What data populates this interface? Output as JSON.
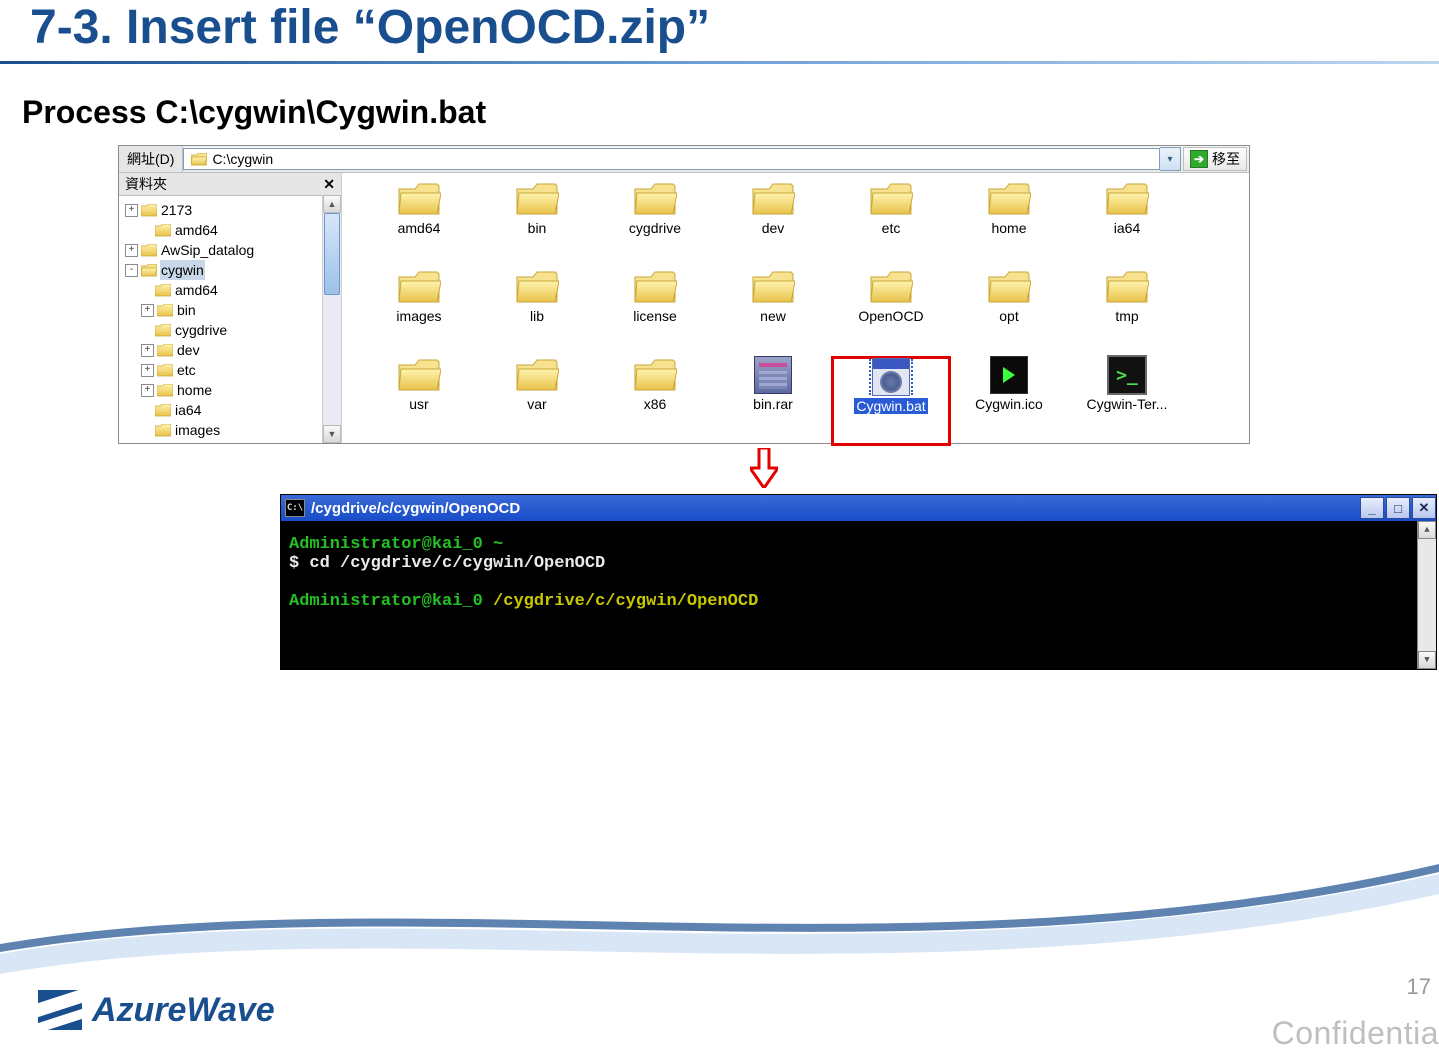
{
  "slide": {
    "title": "7-3. Insert file “OpenOCD.zip”",
    "subheading": "Process C:\\cygwin\\Cygwin.bat"
  },
  "explorer": {
    "address_label": "網址(D)",
    "address_value": "C:\\cygwin",
    "go_label": "移至",
    "tree_header": "資料夾",
    "tree": [
      {
        "indent": 0,
        "toggle": "+",
        "label": "2173"
      },
      {
        "indent": 1,
        "toggle": "",
        "label": "amd64"
      },
      {
        "indent": 0,
        "toggle": "+",
        "label": "AwSip_datalog"
      },
      {
        "indent": 0,
        "toggle": "-",
        "label": "cygwin",
        "selected": true,
        "open": true
      },
      {
        "indent": 1,
        "toggle": "",
        "label": "amd64"
      },
      {
        "indent": 1,
        "toggle": "+",
        "label": "bin"
      },
      {
        "indent": 1,
        "toggle": "",
        "label": "cygdrive"
      },
      {
        "indent": 1,
        "toggle": "+",
        "label": "dev"
      },
      {
        "indent": 1,
        "toggle": "+",
        "label": "etc"
      },
      {
        "indent": 1,
        "toggle": "+",
        "label": "home"
      },
      {
        "indent": 1,
        "toggle": "",
        "label": "ia64"
      },
      {
        "indent": 1,
        "toggle": "",
        "label": "images"
      }
    ],
    "items": [
      {
        "type": "folder",
        "label": "amd64"
      },
      {
        "type": "folder",
        "label": "bin"
      },
      {
        "type": "folder",
        "label": "cygdrive"
      },
      {
        "type": "folder",
        "label": "dev"
      },
      {
        "type": "folder",
        "label": "etc"
      },
      {
        "type": "folder",
        "label": "home"
      },
      {
        "type": "folder",
        "label": "ia64"
      },
      {
        "type": "folder",
        "label": "images"
      },
      {
        "type": "folder",
        "label": "lib"
      },
      {
        "type": "folder",
        "label": "license"
      },
      {
        "type": "folder",
        "label": "new"
      },
      {
        "type": "folder",
        "label": "OpenOCD"
      },
      {
        "type": "folder",
        "label": "opt"
      },
      {
        "type": "folder",
        "label": "tmp"
      },
      {
        "type": "folder",
        "label": "usr"
      },
      {
        "type": "folder",
        "label": "var"
      },
      {
        "type": "folder",
        "label": "x86"
      },
      {
        "type": "rar",
        "label": "bin.rar"
      },
      {
        "type": "bat",
        "label": "Cygwin.bat",
        "selected": true,
        "highlighted": true
      },
      {
        "type": "ico",
        "label": "Cygwin.ico"
      },
      {
        "type": "term",
        "label": "Cygwin-Ter..."
      }
    ]
  },
  "console": {
    "title": "/cygdrive/c/cygwin/OpenOCD",
    "lines": [
      {
        "cls": "green",
        "text": "Administrator@kai_0 ~"
      },
      {
        "cls": "white",
        "text": "$ cd /cygdrive/c/cygwin/OpenOCD"
      },
      {
        "cls": "blank",
        "text": ""
      },
      {
        "cls": "mixed",
        "green": "Administrator@kai_0 ",
        "yellow": "/cygdrive/c/cygwin/OpenOCD"
      }
    ]
  },
  "footer": {
    "brand": "AzureWave",
    "page_number": "17",
    "confidential": "Confidentia"
  }
}
